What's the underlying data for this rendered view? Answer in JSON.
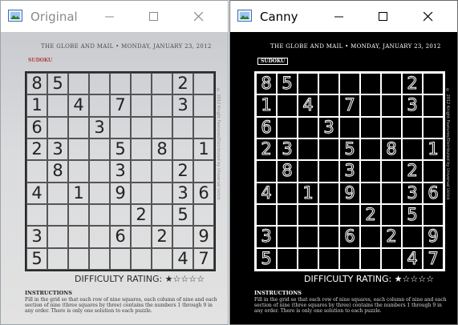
{
  "windows": [
    {
      "title": "Original",
      "controls": {
        "minimize": "minimize",
        "maximize": "maximize",
        "close": "close"
      }
    },
    {
      "title": "Canny",
      "controls": {
        "minimize": "minimize",
        "maximize": "maximize",
        "close": "close"
      }
    }
  ],
  "newspaper": {
    "header": "THE GLOBE AND MAIL • MONDAY, JANUARY 23, 2012",
    "section": "SUDOKU",
    "side_note": "© 2012 Knight Features/Distributed by Universal Uclick",
    "rating_label": "DIFFICULTY RATING: ★☆☆☆☆",
    "instructions_title": "INSTRUCTIONS",
    "instructions_body": "Fill in the grid so that each row of nine squares, each column of nine and each section of nine (three squares by three) contains the numbers 1 through 9 in any order. There is only one solution to each puzzle."
  },
  "sudoku": [
    [
      "8",
      "5",
      "",
      "",
      "",
      "",
      "",
      "2",
      ""
    ],
    [
      "1",
      "",
      "4",
      "",
      "7",
      "",
      "",
      "3",
      ""
    ],
    [
      "6",
      "",
      "",
      "3",
      "",
      "",
      "",
      "",
      ""
    ],
    [
      "2",
      "3",
      "",
      "",
      "5",
      "",
      "8",
      "",
      "1"
    ],
    [
      "",
      "8",
      "",
      "",
      "3",
      "",
      "",
      "2",
      ""
    ],
    [
      "4",
      "",
      "1",
      "",
      "9",
      "",
      "",
      "3",
      "6"
    ],
    [
      "",
      "",
      "",
      "",
      "",
      "2",
      "",
      "5",
      ""
    ],
    [
      "3",
      "",
      "",
      "",
      "6",
      "",
      "2",
      "",
      "9"
    ],
    [
      "5",
      "",
      "",
      "",
      "",
      "",
      "",
      "4",
      "7"
    ]
  ]
}
